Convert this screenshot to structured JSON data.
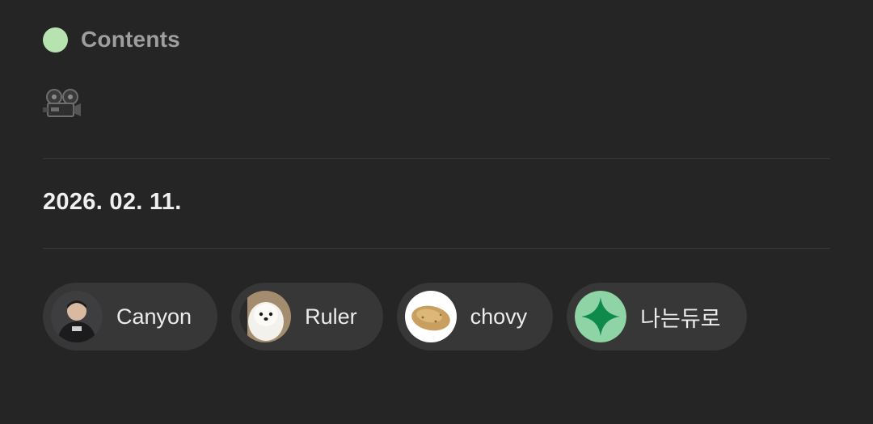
{
  "section": {
    "title": "Contents",
    "dot_color": "#b7e3b0",
    "icon": "movie-camera-icon"
  },
  "entry": {
    "date": "2026. 02. 11."
  },
  "people": [
    {
      "name": "Canyon",
      "avatar": "person-photo"
    },
    {
      "name": "Ruler",
      "avatar": "dog-photo"
    },
    {
      "name": "chovy",
      "avatar": "potato-photo"
    },
    {
      "name": "나는듀로",
      "avatar": "sparkle-icon"
    }
  ],
  "colors": {
    "background": "#252525",
    "chip": "#373737",
    "sparkle_bg": "#8fd4a4",
    "sparkle": "#0e8a4a"
  }
}
